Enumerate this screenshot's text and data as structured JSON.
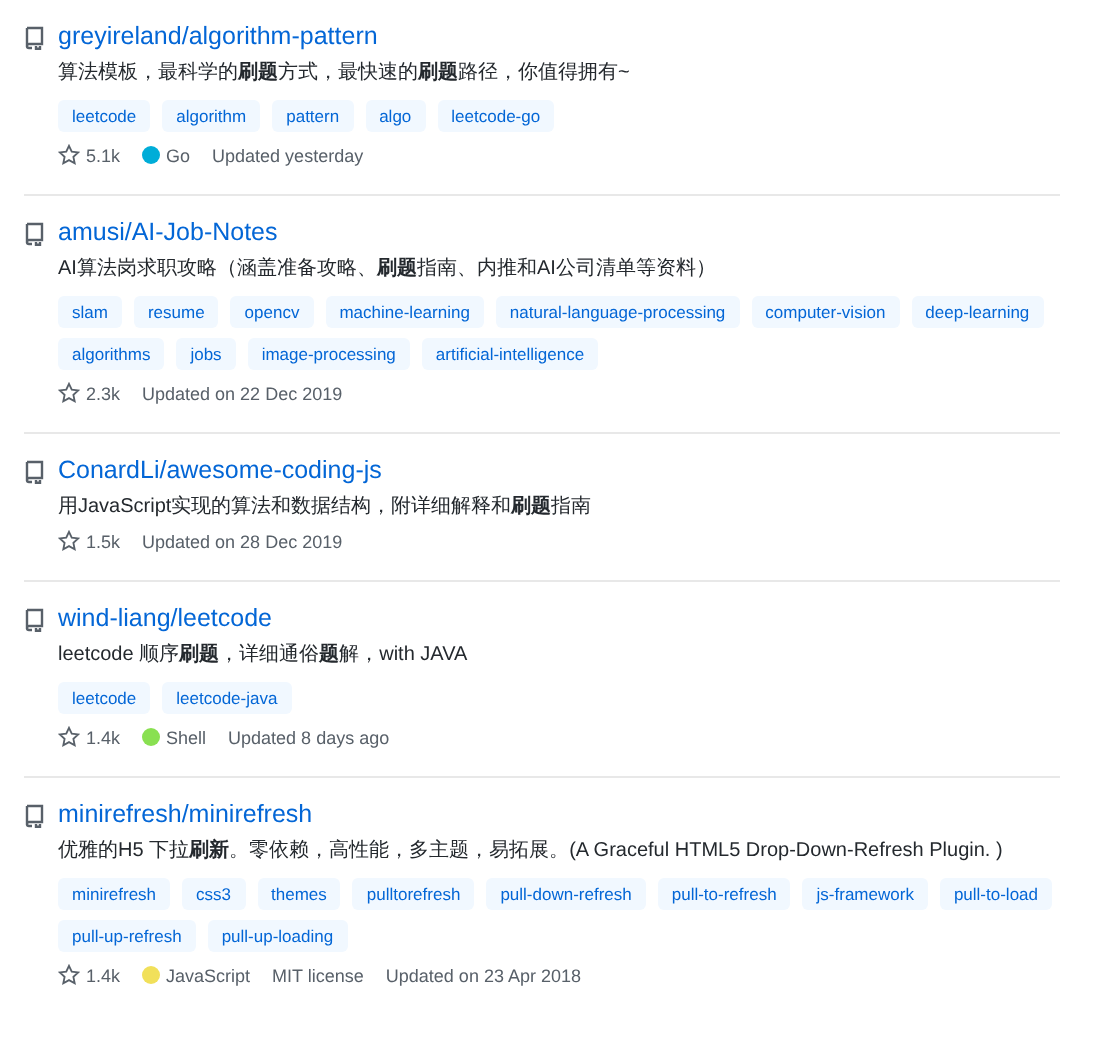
{
  "repos": [
    {
      "name": "greyireland/algorithm-pattern",
      "description": "算法模板，最科学的**刷题**方式，最快速的**刷题**路径，你值得拥有~",
      "topics": [
        "leetcode",
        "algorithm",
        "pattern",
        "algo",
        "leetcode-go"
      ],
      "stars": "5.1k",
      "language": {
        "name": "Go",
        "color": "#00add8"
      },
      "updated": "Updated yesterday"
    },
    {
      "name": "amusi/AI-Job-Notes",
      "description": "AI算法岗求职攻略（涵盖准备攻略、**刷题**指南、内推和AI公司清单等资料）",
      "topics": [
        "slam",
        "resume",
        "opencv",
        "machine-learning",
        "natural-language-processing",
        "computer-vision",
        "deep-learning",
        "algorithms",
        "jobs",
        "image-processing",
        "artificial-intelligence"
      ],
      "stars": "2.3k",
      "updated": "Updated on 22 Dec 2019"
    },
    {
      "name": "ConardLi/awesome-coding-js",
      "description": "用JavaScript实现的算法和数据结构，附详细解释和**刷题**指南",
      "stars": "1.5k",
      "updated": "Updated on 28 Dec 2019"
    },
    {
      "name": "wind-liang/leetcode",
      "description": "leetcode 顺序**刷题**，详细通俗**题**解，with JAVA",
      "topics": [
        "leetcode",
        "leetcode-java"
      ],
      "stars": "1.4k",
      "language": {
        "name": "Shell",
        "color": "#89e051"
      },
      "updated": "Updated 8 days ago"
    },
    {
      "name": "minirefresh/minirefresh",
      "description": "优雅的H5 下拉**刷新**。零依赖，高性能，多主题，易拓展。(A Graceful HTML5 Drop-Down-Refresh Plugin. )",
      "topics": [
        "minirefresh",
        "css3",
        "themes",
        "pulltorefresh",
        "pull-down-refresh",
        "pull-to-refresh",
        "js-framework",
        "pull-to-load",
        "pull-up-refresh",
        "pull-up-loading"
      ],
      "stars": "1.4k",
      "language": {
        "name": "JavaScript",
        "color": "#f1e05a"
      },
      "license": "MIT license",
      "updated": "Updated on 23 Apr 2018"
    }
  ]
}
